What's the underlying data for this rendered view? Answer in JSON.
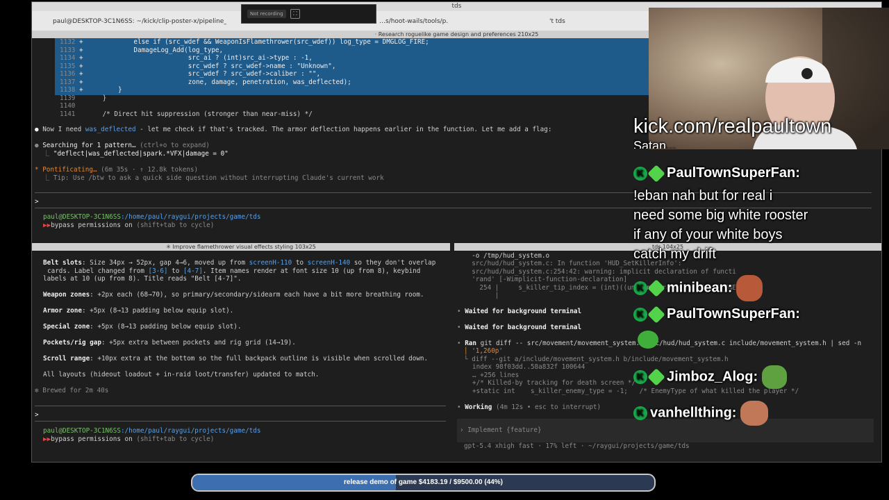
{
  "window": {
    "title": "tds",
    "tabs": [
      {
        "label": "paul@DESKTOP-3C1N6SS: ~/kick/clip-poster-x/pipeline_ui"
      },
      {
        "label": "…s/hoot-wails/tools/p…"
      },
      {
        "label": "'t tds"
      }
    ]
  },
  "recording": {
    "label": "Not recording"
  },
  "top_pane": {
    "header": "· Research roguelike game design and preferences 210x25",
    "diff_lines": [
      {
        "num": "1132",
        "sign": "+",
        "code": "            else if (src_wdef && WeaponIsFlamethrower(src_wdef)) log_type = DMGLOG_FIRE;"
      },
      {
        "num": "1133",
        "sign": "+",
        "code": "            DamageLog_Add(log_type,"
      },
      {
        "num": "1134",
        "sign": "+",
        "code": "                          src_ai ? (int)src_ai->type : -1,"
      },
      {
        "num": "1135",
        "sign": "+",
        "code": "                          src_wdef ? src_wdef->name : \"Unknown\","
      },
      {
        "num": "1136",
        "sign": "+",
        "code": "                          src_wdef ? src_wdef->caliber : \"\","
      },
      {
        "num": "1137",
        "sign": "+",
        "code": "                          zone, damage, penetration, was_deflected);"
      },
      {
        "num": "1138",
        "sign": "+",
        "code": "        }"
      }
    ],
    "plain_lines": [
      {
        "num": "1139",
        "code": "    }"
      },
      {
        "num": "1140",
        "code": ""
      },
      {
        "num": "1141",
        "code": "    /* Direct hit suppression (stronger than near-miss) */"
      }
    ],
    "note_prefix": "Now I need ",
    "note_var": "was_deflected",
    "note_suffix": " - let me check if that's tracked. The armor deflection happens earlier in the function. Let me add a flag:",
    "search_label": "Searching for 1 pattern…",
    "search_hint": " (ctrl+o to expand)",
    "search_pattern": "\"deflect|was_deflected|spark.*VFX|damage = 0\"",
    "status_label": "Pontificating…",
    "status_meta": " (6m 35s · ↑ 12.8k tokens)",
    "tip": "Tip: Use /btw to ask a quick side question without interrupting Claude's current work",
    "prompt_char": ">",
    "cwd_user": "paul@DESKTOP-3C1N6SS",
    "cwd_path": ":/home/paul/raygui/projects/game/tds",
    "bypass": "bypass permissions on",
    "bypass_hint": " (shift+tab to cycle)"
  },
  "left_pane": {
    "header": "✳ Improve flamethrower visual effects styling 103x25",
    "para1_label": "Belt slots",
    "para1_a": ": Size 34px → 52px, gap 4→6, moved up from ",
    "para1_b": "screenH-110",
    "para1_c": " to ",
    "para1_d": "screenH-140",
    "para1_e": " so they don't overlap",
    "para1_line2a": "cards. Label changed from ",
    "para1_line2b": "[3-6]",
    "para1_line2c": " to ",
    "para1_line2d": "[4-7]",
    "para1_line2e": ". Item names render at font size 10 (up from 8), keybind",
    "para1_line3": "labels at 10 (up from 8). Title reads \"Belt [4-7]\".",
    "weapon_label": "Weapon zones",
    "weapon_text": ": +2px each (68→70), so primary/secondary/sidearm each have a bit more breathing room.",
    "armor_label": "Armor zone",
    "armor_text": ": +5px (8→13 padding below equip slot).",
    "special_label": "Special zone",
    "special_text": ": +5px (8→13 padding below equip slot).",
    "pockets_label": "Pockets/rig gap",
    "pockets_text": ": +5px extra between pockets and rig grid (14→19).",
    "scroll_label": "Scroll range",
    "scroll_text": ": +10px extra at the bottom so the full backpack outline is visible when scrolled down.",
    "layouts": "All layouts (hideout loadout + in-raid loot/transfer) updated to match.",
    "brewed": "Brewed for 2m 40s",
    "prompt_char": ">",
    "cwd_user": "paul@DESKTOP-3C1N6SS",
    "cwd_path": ":/home/paul/raygui/projects/game/tds",
    "bypass": "bypass permissions on",
    "bypass_hint": " (shift+tab to cycle)"
  },
  "right_pane": {
    "header": "tds 104x25",
    "l1": "  -o /tmp/hud_system.o",
    "l2": "  src/hud/hud_system.c: In function 'HUD_SetKillerInfo':",
    "l3": "  src/hud/hud_system.c:254:42: warning: implicit declaration of functi",
    "l4": "  'rand' [-Wimplicit-function-declaration]",
    "l5": "    254 |     s_killer_tip_index = (int)((unsigned)rand() % KILLER_ENEMY);",
    "l6": "        |",
    "waited1": "Waited for background terminal",
    "waited2": "Waited for background terminal",
    "ran_label": "Ran",
    "ran_cmd": " git diff -- src/movement/movement_system.c src/hud/hud_system.c include/movement_system.h | sed -n",
    "ran_arg": "'1,260p'",
    "d1": "diff --git a/include/movement_system.h b/include/movement_system.h",
    "d2": "index 98f03dd..58a832f 100644",
    "d3": "… +256 lines",
    "d4": "+/* Killed-by tracking for death screen */",
    "d5": "+static int    s_killer_enemy_type = -1;   /* EnemyType of what killed the player */",
    "working": "Working",
    "working_meta": " (4m 12s • esc to interrupt)",
    "input_placeholder": "Implement {feature}",
    "footer": "gpt-5.4 xhigh fast · 17% left · ~/raygui/projects/game/tds"
  },
  "overlay": {
    "kick_url": "kick.com/realpaultown",
    "cut_text": "Satan..."
  },
  "chat": [
    {
      "user": "PaulTownSuperFan:",
      "message_lines": [
        "!eban nah but for real i",
        "need some big white rooster",
        "if any of your white boys",
        "catch my drift"
      ]
    },
    {
      "user": "minibean:",
      "message_lines": []
    },
    {
      "user": "PaulTownSuperFan:",
      "message_lines": []
    },
    {
      "user": "Jimboz_Alog:",
      "message_lines": []
    },
    {
      "user": "vanhellthing:",
      "message_lines": []
    }
  ],
  "progress": {
    "label": "release demo of game $4183.19 / $9500.00 (44%)",
    "fraction": 0.44
  }
}
